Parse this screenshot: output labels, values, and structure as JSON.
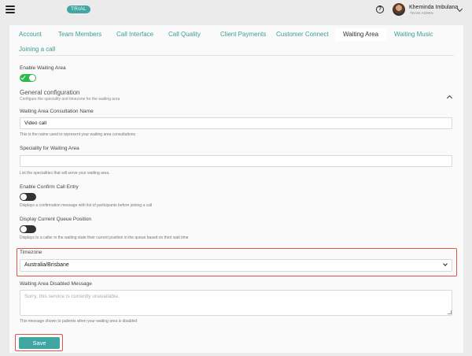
{
  "header": {
    "badge": "TRIAL",
    "help_symbol": "?",
    "user_name": "Kheminda Imbulana",
    "user_role": "TEAM ADMIN"
  },
  "tabs": [
    {
      "label": "Account",
      "active": false
    },
    {
      "label": "Team Members",
      "active": false
    },
    {
      "label": "Call Interface",
      "active": false
    },
    {
      "label": "Call Quality",
      "active": false
    },
    {
      "label": "Client Payments",
      "active": false
    },
    {
      "label": "Customer Connect",
      "active": false
    },
    {
      "label": "Waiting Area",
      "active": true
    },
    {
      "label": "Waiting Music",
      "active": false
    },
    {
      "label": "Joining a call",
      "active": false
    }
  ],
  "form": {
    "enable_waiting_area": {
      "label": "Enable Waiting Area",
      "on": true
    },
    "general_configuration": {
      "title": "General configuration",
      "subtitle": "Configure the speciality and timezone for the waiting area"
    },
    "consultation_name": {
      "label": "Waiting Area Consultation Name",
      "value": "Video call",
      "help": "This is the name used to represent your waiting area consultations"
    },
    "speciality": {
      "label": "Speciality for Waiting Area",
      "value": "",
      "help": "List the specialities that will serve your waiting area."
    },
    "confirm_call_entry": {
      "label": "Enable Confirm Call Entry",
      "on": false,
      "help": "Displays a confirmation message with list of participants before joining a call"
    },
    "queue_position": {
      "label": "Display Current Queue Position",
      "on": false,
      "help": "Displays to a caller in the waiting state their current position in the queue based on their wait time"
    },
    "timezone": {
      "label": "Timezone",
      "value": "Australia/Brisbane"
    },
    "disabled_message": {
      "label": "Waiting Area Disabled Message",
      "placeholder": "Sorry, this service is currently unavailable.",
      "help": "This message shown to patients when your waiting area is disabled"
    },
    "save_label": "Save"
  },
  "colors": {
    "accent": "#3fa6a2",
    "toggle_on": "#2eb84e",
    "highlight": "#e0544b"
  },
  "icons": [
    "menu-icon",
    "help-icon",
    "chevron-down-icon",
    "chevron-up-icon",
    "check-icon"
  ]
}
